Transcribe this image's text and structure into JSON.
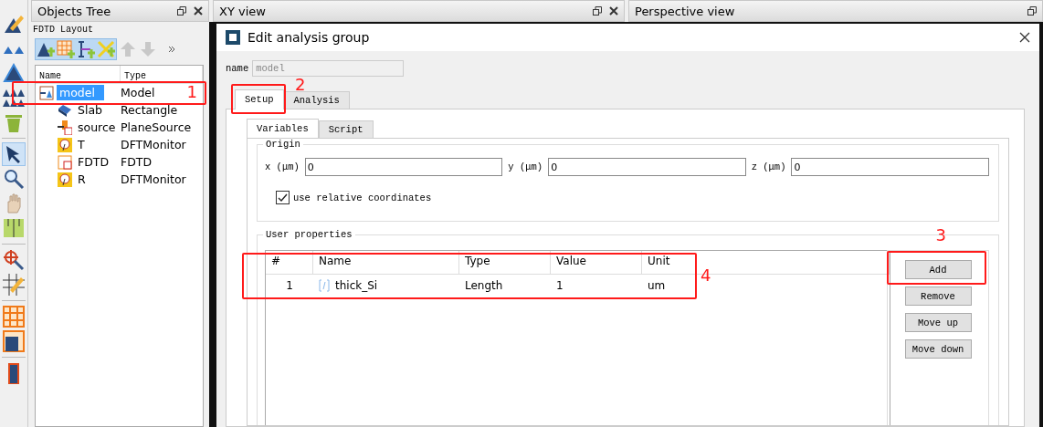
{
  "objects_tree": {
    "title": "Objects Tree",
    "subtitle": "FDTD Layout",
    "columns": [
      "Name",
      "Type"
    ],
    "rows": [
      {
        "name": "model",
        "type": "Model",
        "kind": "model",
        "selected": true,
        "children": [
          {
            "name": "Slab",
            "type": "Rectangle",
            "kind": "rect",
            "selected": false
          },
          {
            "name": "source",
            "type": "PlaneSource",
            "kind": "source",
            "selected": false
          },
          {
            "name": "T",
            "type": "DFTMonitor",
            "kind": "monitor",
            "selected": false
          },
          {
            "name": "FDTD",
            "type": "FDTD",
            "kind": "fdtd",
            "selected": false
          },
          {
            "name": "R",
            "type": "DFTMonitor",
            "kind": "monitor",
            "selected": false
          }
        ]
      }
    ]
  },
  "views": [
    {
      "title": "XY view"
    },
    {
      "title": "Perspective view"
    }
  ],
  "dialog": {
    "title": "Edit analysis group",
    "name_label": "name",
    "name_value": "model",
    "tabs": [
      {
        "label": "Setup",
        "selected": true
      },
      {
        "label": "Analysis",
        "selected": false
      }
    ],
    "subtabs": [
      {
        "label": "Variables",
        "selected": true
      },
      {
        "label": "Script",
        "selected": false
      }
    ],
    "origin": {
      "title": "Origin",
      "fields": [
        {
          "label": "x (μm)",
          "value": "0"
        },
        {
          "label": "y (μm)",
          "value": "0"
        },
        {
          "label": "z (μm)",
          "value": "0"
        }
      ],
      "checkbox": {
        "label": "use relative coordinates",
        "checked": true
      }
    },
    "user_properties": {
      "title": "User properties",
      "columns": [
        "#",
        "Name",
        "Type",
        "Value",
        "Unit"
      ],
      "rows": [
        {
          "index": "1",
          "name": "thick_Si",
          "type": "Length",
          "value": "1",
          "unit": "um"
        }
      ],
      "buttons": [
        "Add",
        "Remove",
        "Move up",
        "Move down"
      ]
    }
  },
  "annotations": [
    {
      "label": "1"
    },
    {
      "label": "2"
    },
    {
      "label": "3"
    },
    {
      "label": "4"
    }
  ]
}
